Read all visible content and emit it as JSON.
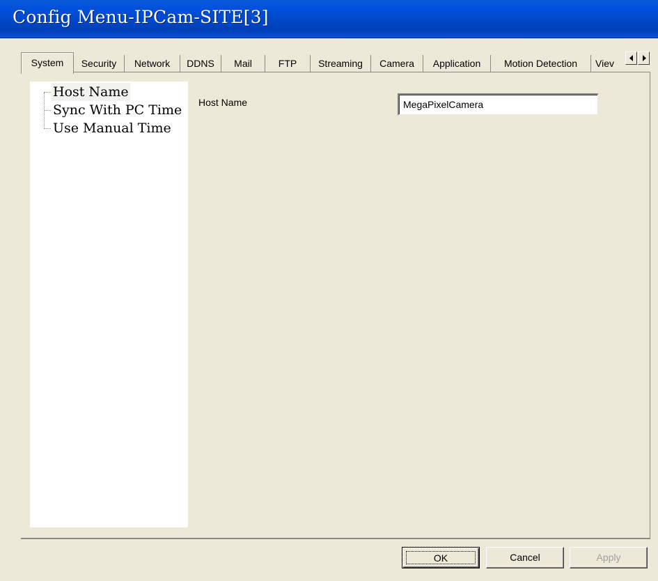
{
  "window": {
    "title": "Config Menu-IPCam-SITE[3]"
  },
  "tabs": [
    {
      "label": "System",
      "selected": true
    },
    {
      "label": "Security"
    },
    {
      "label": "Network"
    },
    {
      "label": "DDNS"
    },
    {
      "label": "Mail"
    },
    {
      "label": "FTP"
    },
    {
      "label": "Streaming"
    },
    {
      "label": "Camera"
    },
    {
      "label": "Application"
    },
    {
      "label": "Motion Detection"
    },
    {
      "label": "Viev"
    }
  ],
  "tab_scroll": {
    "left_icon": "arrow-left-icon",
    "right_icon": "arrow-right-icon"
  },
  "tree": {
    "items": [
      {
        "label": "Host Name",
        "selected": true
      },
      {
        "label": "Sync With PC Time"
      },
      {
        "label": "Use Manual Time"
      }
    ]
  },
  "form": {
    "host_name_label": "Host Name",
    "host_name_value": "MegaPixelCamera"
  },
  "buttons": {
    "ok": "OK",
    "cancel": "Cancel",
    "apply": "Apply"
  },
  "colors": {
    "titlebar": "#0047c8",
    "dialog_bg": "#ece9d8"
  }
}
